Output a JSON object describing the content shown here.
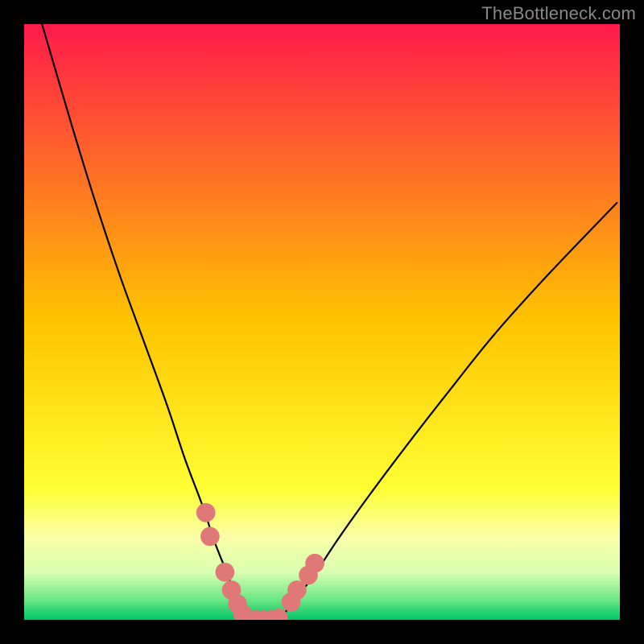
{
  "watermark": "TheBottleneck.com",
  "chart_data": {
    "type": "line",
    "title": "",
    "xlabel": "",
    "ylabel": "",
    "xlim": [
      0,
      100
    ],
    "ylim": [
      0,
      100
    ],
    "grid": false,
    "legend": false,
    "background_gradient": {
      "stops": [
        {
          "offset": 0.0,
          "color": "#ff1a4b"
        },
        {
          "offset": 0.5,
          "color": "#ffc400"
        },
        {
          "offset": 0.78,
          "color": "#ffff33"
        },
        {
          "offset": 0.86,
          "color": "#fbffa6"
        },
        {
          "offset": 0.92,
          "color": "#d9ffb0"
        },
        {
          "offset": 0.965,
          "color": "#6fe887"
        },
        {
          "offset": 1.0,
          "color": "#00c566"
        }
      ]
    },
    "series": [
      {
        "name": "curve-left",
        "x": [
          3,
          8,
          12,
          16,
          20,
          24,
          27,
          30,
          32,
          34,
          35.5,
          36.5,
          37.3
        ],
        "y": [
          100,
          83,
          70,
          58,
          47,
          36,
          27,
          19,
          13,
          8,
          4,
          1.5,
          0
        ],
        "color": "#000000"
      },
      {
        "name": "curve-right",
        "x": [
          42.7,
          44,
          46,
          49,
          53,
          58,
          64,
          71,
          79,
          88,
          99.5
        ],
        "y": [
          0,
          1.5,
          4,
          8,
          14,
          21,
          29,
          38,
          48,
          58,
          70
        ],
        "color": "#000000"
      }
    ],
    "markers": {
      "name": "highlight-markers",
      "color": "#e07878",
      "radius_pct": 1.6,
      "points": [
        {
          "x": 30.5,
          "y": 18
        },
        {
          "x": 31.2,
          "y": 14
        },
        {
          "x": 33.7,
          "y": 8
        },
        {
          "x": 34.8,
          "y": 5
        },
        {
          "x": 35.8,
          "y": 2.7
        },
        {
          "x": 36.7,
          "y": 1
        },
        {
          "x": 37.7,
          "y": 0
        },
        {
          "x": 39.0,
          "y": 0
        },
        {
          "x": 40.3,
          "y": 0
        },
        {
          "x": 41.5,
          "y": 0
        },
        {
          "x": 42.7,
          "y": 0.3
        },
        {
          "x": 44.8,
          "y": 3
        },
        {
          "x": 45.8,
          "y": 5
        },
        {
          "x": 47.7,
          "y": 7.5
        },
        {
          "x": 48.8,
          "y": 9.5
        }
      ]
    }
  }
}
